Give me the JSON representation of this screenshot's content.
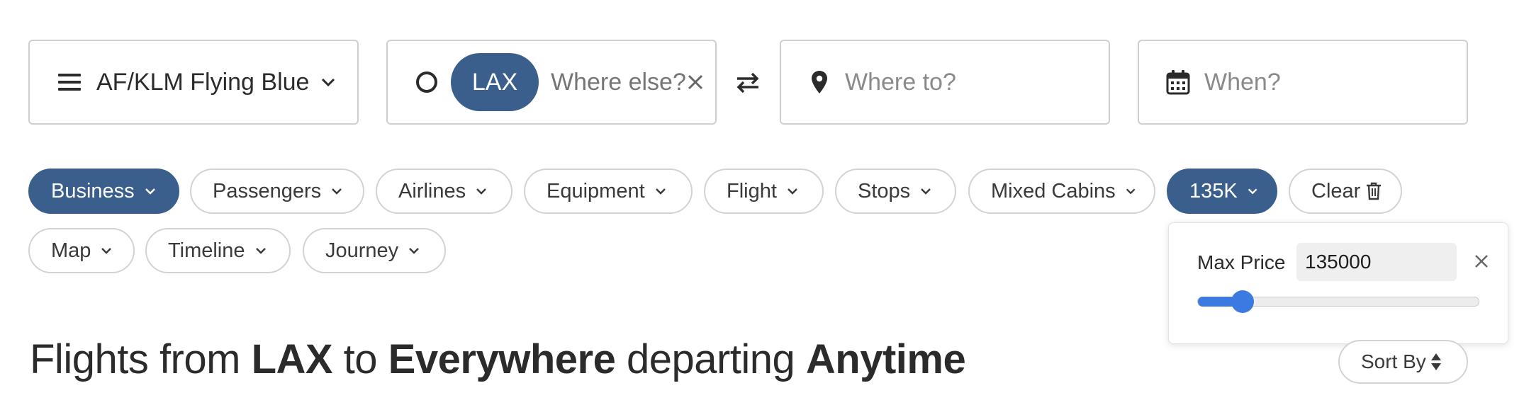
{
  "program": {
    "label": "AF/KLM Flying Blue"
  },
  "origin": {
    "chip_label": "LAX",
    "placeholder": "Where else?"
  },
  "destination": {
    "placeholder": "Where to?"
  },
  "date": {
    "placeholder": "When?"
  },
  "filters": [
    {
      "label": "Business",
      "active": true
    },
    {
      "label": "Passengers",
      "active": false
    },
    {
      "label": "Airlines",
      "active": false
    },
    {
      "label": "Equipment",
      "active": false
    },
    {
      "label": "Flight",
      "active": false
    },
    {
      "label": "Stops",
      "active": false
    },
    {
      "label": "Mixed Cabins",
      "active": false
    },
    {
      "label": "135K",
      "active": true
    },
    {
      "label": "Clear",
      "active": false
    },
    {
      "label": "Map",
      "active": false
    },
    {
      "label": "Timeline",
      "active": false
    },
    {
      "label": "Journey",
      "active": false
    }
  ],
  "max_price": {
    "label": "Max Price",
    "value": "135000",
    "slider_level": 0.16
  },
  "results": {
    "prefix": "Flights from ",
    "origin": "LAX",
    "to": " to ",
    "destination": "Everywhere",
    "departing": " departing ",
    "when": "Anytime"
  },
  "sort": {
    "label": "Sort By"
  },
  "colors": {
    "accent": "#3a5f8d",
    "slider": "#3b7ae0"
  }
}
